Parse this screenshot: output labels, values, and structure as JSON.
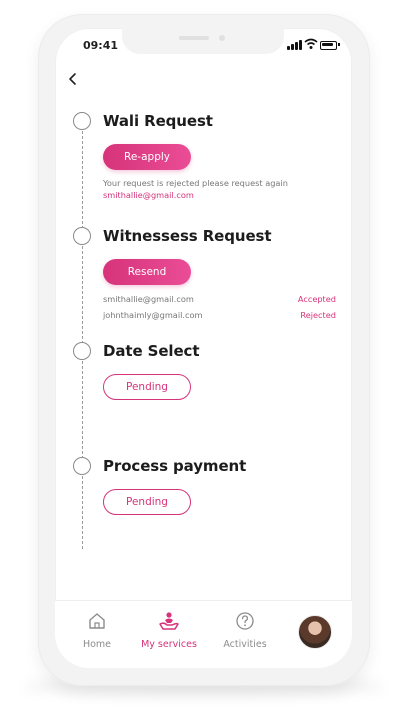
{
  "status_bar": {
    "time": "09:41"
  },
  "steps": [
    {
      "title": "Wali Request",
      "button": "Re-apply",
      "note": "Your request is rejected please request again",
      "email": "smithallie@gmail.com"
    },
    {
      "title": "Witnessess Request",
      "button": "Resend",
      "witnesses": [
        {
          "email": "smithallie@gmail.com",
          "status": "Accepted"
        },
        {
          "email": "johnthaimly@gmail.com",
          "status": "Rejected"
        }
      ]
    },
    {
      "title": "Date Select",
      "button": "Pending"
    },
    {
      "title": "Process payment",
      "button": "Pending"
    }
  ],
  "nav": {
    "items": [
      {
        "label": "Home",
        "icon": "home-icon"
      },
      {
        "label": "My services",
        "icon": "services-icon",
        "active": true
      },
      {
        "label": "Activities",
        "icon": "help-circle-icon"
      }
    ]
  },
  "colors": {
    "accent": "#d6337a",
    "line": "#9a9a9a",
    "muted": "#777777"
  }
}
